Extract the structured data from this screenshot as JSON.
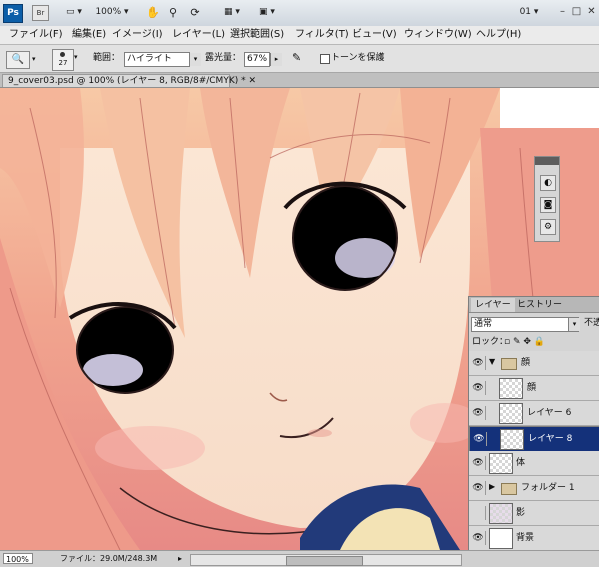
{
  "app": {
    "logo": "Ps",
    "bridge": "Br",
    "zoom": "100%",
    "workspace": "01"
  },
  "menu": [
    "ファイル(F)",
    "編集(E)",
    "イメージ(I)",
    "レイヤー(L)",
    "選択範囲(S)",
    "フィルタ(T)",
    "ビュー(V)",
    "ウィンドウ(W)",
    "ヘルプ(H)"
  ],
  "options": {
    "brush_size": "27",
    "range_label": "範囲：",
    "range_value": "ハイライト",
    "exposure_label": "露光量：",
    "exposure_value": "67%",
    "protect_tone": "トーンを保護"
  },
  "document": {
    "tab_title": "9_cover03.psd @ 100% (レイヤー 8, RGB/8#/CMYK) *"
  },
  "layers_panel": {
    "tabs": [
      "レイヤー",
      "ヒストリー"
    ],
    "blend_mode": "通常",
    "opacity_label": "不透",
    "lock_label": "ロック：",
    "layers": [
      {
        "name": "顔",
        "type": "group",
        "expanded": true,
        "visible": true
      },
      {
        "name": "顔",
        "type": "layer",
        "visible": true
      },
      {
        "name": "レイヤー 6",
        "type": "layer",
        "visible": true
      },
      {
        "name": "レイヤー 8",
        "type": "layer",
        "visible": true,
        "selected": true
      },
      {
        "name": "体",
        "type": "layer",
        "visible": true
      },
      {
        "name": "フォルダー 1",
        "type": "group",
        "expanded": false,
        "visible": true
      },
      {
        "name": "影",
        "type": "layer",
        "visible": false
      },
      {
        "name": "背景",
        "type": "layer",
        "visible": true
      }
    ]
  },
  "status": {
    "zoom": "100%",
    "file_info": "ファイル：29.0M/248.3M"
  },
  "colors": {
    "selected_layer": "#14317a",
    "ps_blue": "#0b5ea8"
  }
}
